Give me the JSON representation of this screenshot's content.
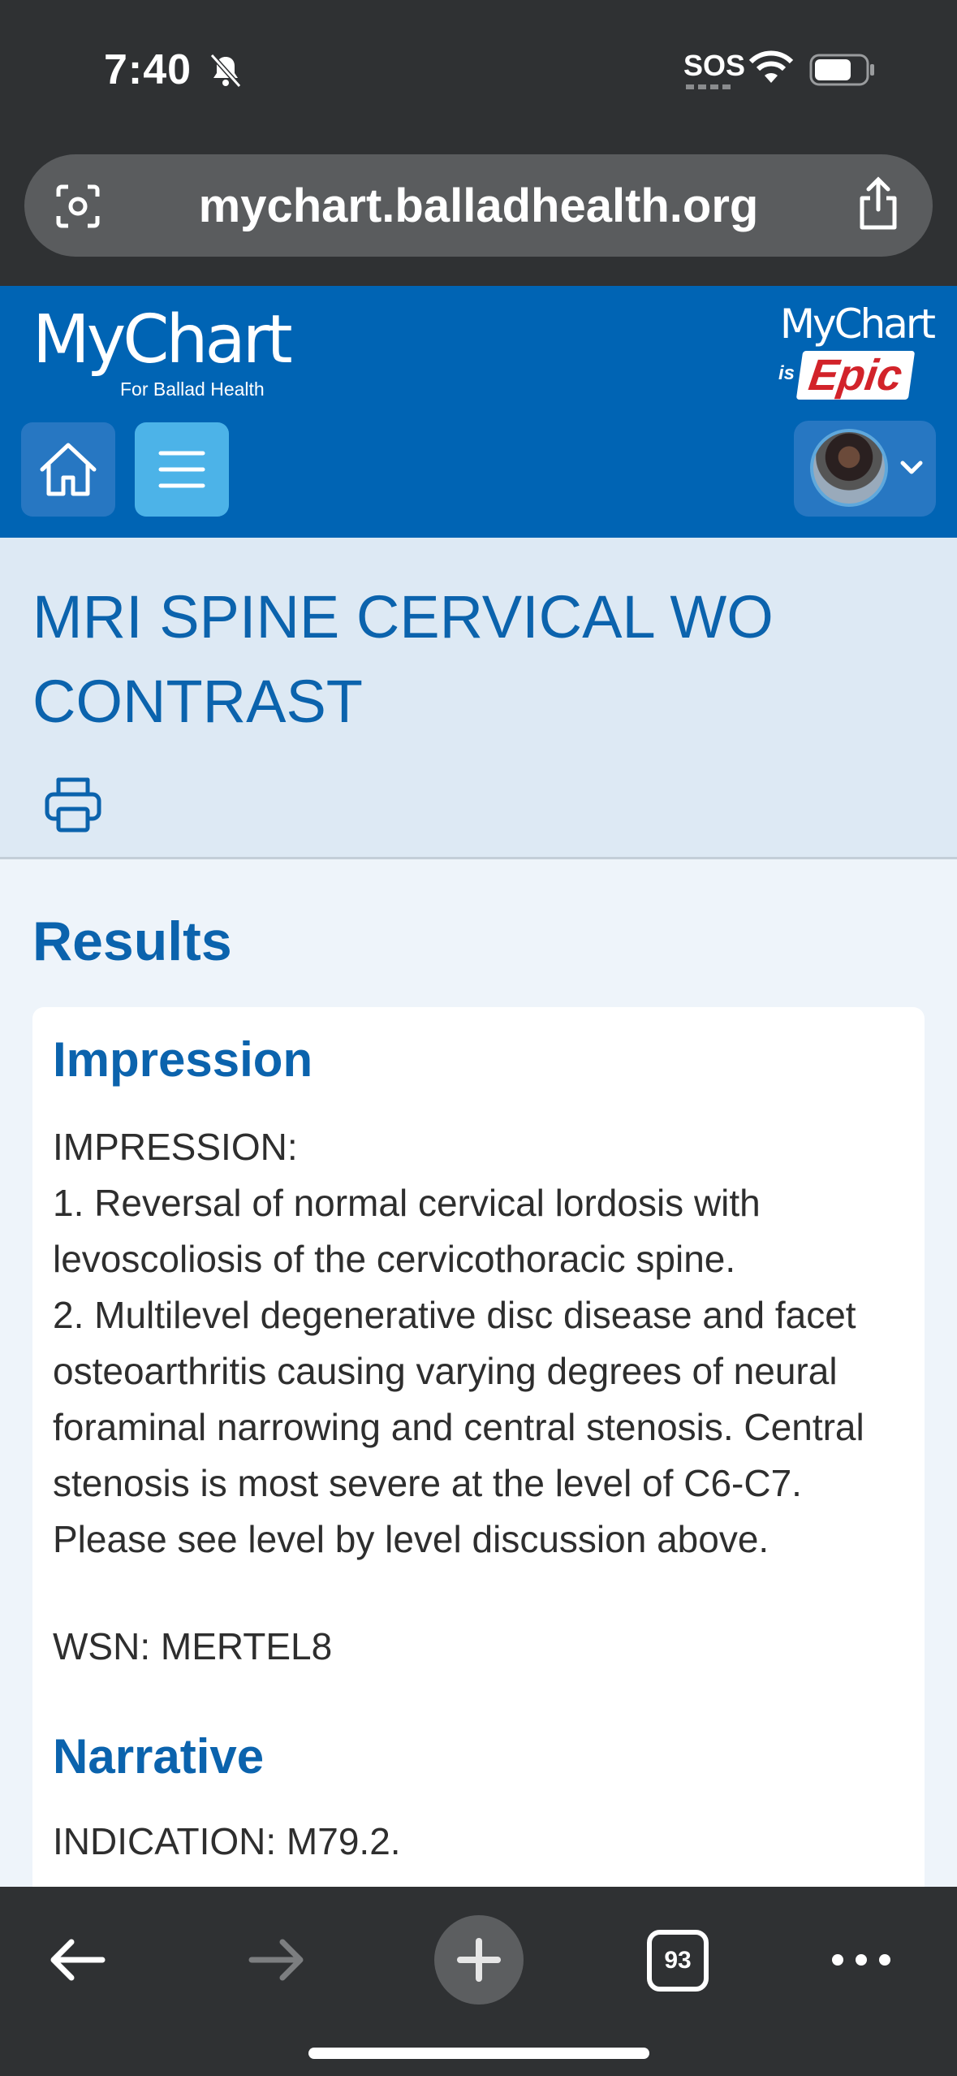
{
  "status_bar": {
    "time": "7:40",
    "sos": "SOS",
    "icons": [
      "bell-slash-icon",
      "wifi-icon",
      "battery-icon"
    ]
  },
  "browser": {
    "url": "mychart.balladhealth.org",
    "tab_count": "93",
    "icons": [
      "camera-scan-icon",
      "share-icon",
      "back-arrow-icon",
      "forward-arrow-icon",
      "new-tab-icon",
      "tabs-icon",
      "more-icon"
    ]
  },
  "header": {
    "logo_text": "MyChart",
    "logo_subtext": "For Ballad Health",
    "epic_top": "MyChart",
    "epic_is": "is",
    "epic_word": "Epic",
    "accent_color": "#0064b4",
    "icons": [
      "home-icon",
      "menu-icon",
      "chevron-down-icon"
    ]
  },
  "page": {
    "title": "MRI SPINE CERVICAL WO CONTRAST",
    "print_icon": "printer-icon"
  },
  "results": {
    "heading": "Results",
    "impression_heading": "Impression",
    "impression_text": "IMPRESSION:\n1. Reversal of normal cervical lordosis with levoscoliosis of the cervicothoracic spine.\n2. Multilevel degenerative disc disease and facet osteoarthritis causing varying degrees of neural foraminal narrowing and central stenosis. Central stenosis is most severe at the level of C6-C7. Please see level by level discussion above.",
    "wsn": "WSN: MERTEL8",
    "narrative_heading": "Narrative",
    "indication": "INDICATION: M79.2."
  }
}
